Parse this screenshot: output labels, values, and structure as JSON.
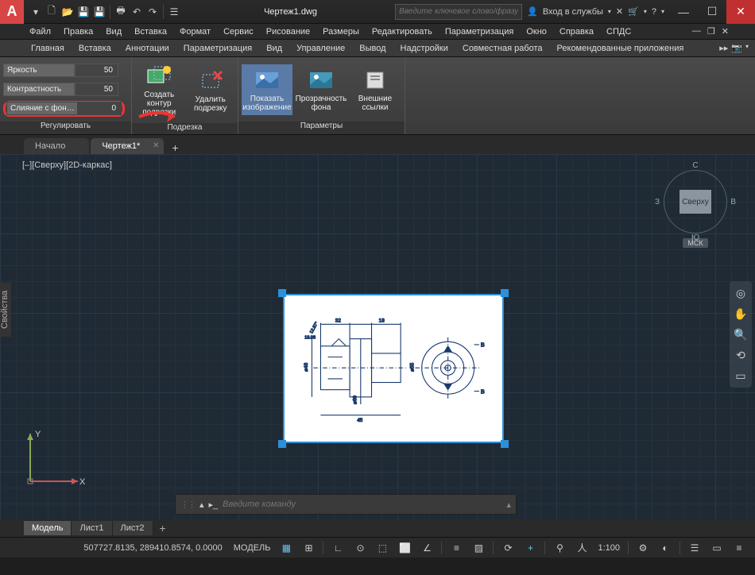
{
  "title": "Чертеж1.dwg",
  "search_placeholder": "Введите ключевое слово/фразу",
  "signin": "Вход в службы",
  "menu": [
    "Файл",
    "Правка",
    "Вид",
    "Вставка",
    "Формат",
    "Сервис",
    "Рисование",
    "Размеры",
    "Редактировать",
    "Параметризация",
    "Окно",
    "Справка",
    "СПДС"
  ],
  "ribbon_tabs": [
    "Главная",
    "Вставка",
    "Аннотации",
    "Параметризация",
    "Вид",
    "Управление",
    "Вывод",
    "Надстройки",
    "Совместная работа",
    "Рекомендованные приложения"
  ],
  "panels": {
    "adjust": {
      "label": "Регулировать",
      "brightness_label": "Яркость",
      "brightness_value": "50",
      "contrast_label": "Контрастность",
      "contrast_value": "50",
      "fade_label": "Слияние с фон…",
      "fade_value": "0"
    },
    "clip": {
      "label": "Подрезка",
      "create": "Создать контур подрезки",
      "remove": "Удалить подрезку"
    },
    "options": {
      "label": "Параметры",
      "show": "Показать изображение",
      "transp": "Прозрачность фона",
      "xref": "Внешние ссылки"
    }
  },
  "file_tabs": {
    "start": "Начало",
    "drawing": "Чертеж1*"
  },
  "view_label": "[–][Сверху][2D-каркас]",
  "properties_label": "Свойства",
  "viewcube": {
    "top": "Сверху",
    "n": "С",
    "s": "Ю",
    "e": "В",
    "w": "З",
    "wcs": "МСК"
  },
  "command_placeholder": "Введите команду",
  "layout_tabs": {
    "model": "Модель",
    "l1": "Лист1",
    "l2": "Лист2"
  },
  "status": {
    "coords": "507727.8135, 289410.8574, 0.0000",
    "model": "МОДЕЛЬ",
    "scale": "1:100"
  }
}
